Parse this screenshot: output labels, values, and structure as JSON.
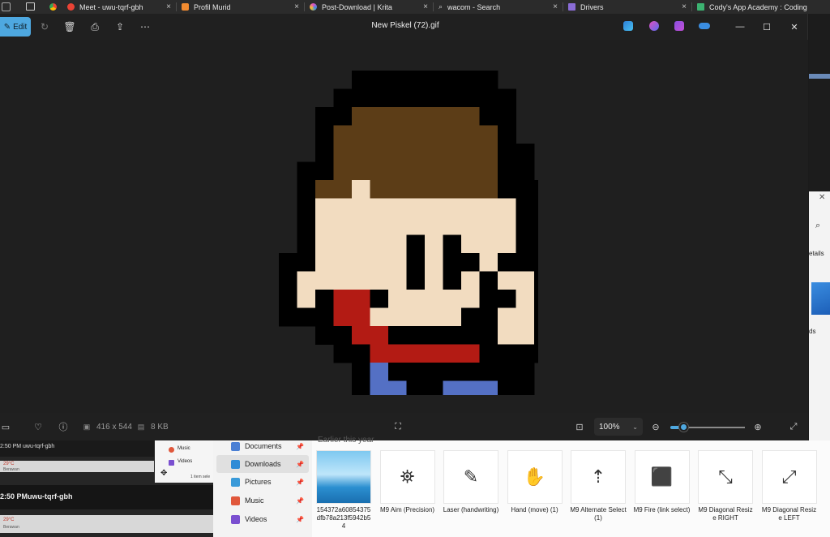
{
  "browser": {
    "tabs": [
      {
        "label": "Meet - uwu-tqrf-gbh",
        "color": "#ea4335"
      },
      {
        "label": "Profil Murid",
        "color": "#f28b30"
      },
      {
        "label": "Post-Download | Krita",
        "color": "#e04fc0"
      },
      {
        "label": "wacom - Search",
        "color": "#3a8de0"
      },
      {
        "label": "Drivers",
        "color": "#8a6cd6"
      },
      {
        "label": "Cody's App Academy : Coding",
        "color": "#3cb371"
      }
    ],
    "close_glyph": "×"
  },
  "viewer": {
    "edit_label": "Edit",
    "title": "New Piskel (72).gif",
    "dimensions": "416 x 544",
    "file_size": "8 KB",
    "zoom": "100%",
    "icons": [
      "edit-icon",
      "rotate-icon",
      "delete-icon",
      "print-icon",
      "share-icon",
      "more-icon",
      "minimize-icon",
      "maximize-icon",
      "close-icon",
      "filmstrip-icon",
      "favorite-icon",
      "info-icon",
      "fit-icon",
      "zoom-out-icon",
      "zoom-in-icon",
      "fullscreen-icon"
    ],
    "colors": {
      "accent": "#4ea8e0",
      "background": "#1f1f1f"
    }
  },
  "pixel_art": {
    "palette": {
      "K": "#000000",
      "H": "#5c3d17",
      "S": "#f2dcc0",
      "R": "#b31b14",
      "B": "#5470c4",
      "D": "#4a3018"
    },
    "rows": [
      "....KKKKKKKK",
      "...KKKKKKKKKK",
      "..KKHHHHHHHKK",
      "..KHHHHHHHHHK",
      "..KHHHHHHHHHKK",
      ".KKHHHHHHHHHKK",
      ".KHHSHHHHHHHKKK",
      ".KSSSSSSSSSSSKK",
      ".KSSSSSSSSSSSKK",
      ".KSSSSSKSKSSSKK",
      "KKSSSSSKSKKSKKK",
      "KSSSSSSKSKSKSSKK",
      "KSKRRKSSSSSKKSKK",
      "KKKRRSSSSSKKSSKK",
      "..KKRRKKKKKKSSKK",
      "...KKRRRRRRKKKK",
      "....KBKKKKKKKK",
      "....KBBKKBBBKK",
      "....KBBKKBBBK",
      "....KBBKKKKKK",
      "....KDDKKKKK",
      "....KKDKKKK",
      "....KKKKK"
    ]
  },
  "taskbar_previews": {
    "time1": "2:50 PM",
    "meeting1": "uwu-tqrf-gbh",
    "time2": "2:50 PM",
    "meeting2": "uwu-tqrf-gbh",
    "weather1": "29°C",
    "weather2": "29°C",
    "weather_desc": "Berawan",
    "mini_music": "Music",
    "mini_videos": "Videos",
    "mini_selected": "1 item sele"
  },
  "explorer": {
    "section_label": "Earlier this year",
    "nav": [
      {
        "label": "Documents",
        "color": "#4a7fd4"
      },
      {
        "label": "Downloads",
        "color": "#2e8bd6"
      },
      {
        "label": "Pictures",
        "color": "#3a9ad9"
      },
      {
        "label": "Music",
        "color": "#e0573b"
      },
      {
        "label": "Videos",
        "color": "#7a4fd0"
      }
    ],
    "files": [
      {
        "name": "154372a60854375dfb78a213f5942b54",
        "icon": "image-thumbnail"
      },
      {
        "name": "M9 Aim (Precision)",
        "icon": "aim-cursor-icon"
      },
      {
        "name": "Laser (handwriting)",
        "icon": "laser-cursor-icon"
      },
      {
        "name": "Hand (move) (1)",
        "icon": "hand-cursor-icon"
      },
      {
        "name": "M9 Alternate Select (1)",
        "icon": "alternate-cursor-icon"
      },
      {
        "name": "M9 Fire (link select)",
        "icon": "link-cursor-icon"
      },
      {
        "name": "M9 Diagonal Resize RIGHT",
        "icon": "diagonal-right-cursor-icon"
      },
      {
        "name": "M9 Diagonal Resize LEFT",
        "icon": "diagonal-left-cursor-icon"
      }
    ],
    "right_fragments": {
      "details": "etails",
      "loads": "ds"
    }
  }
}
